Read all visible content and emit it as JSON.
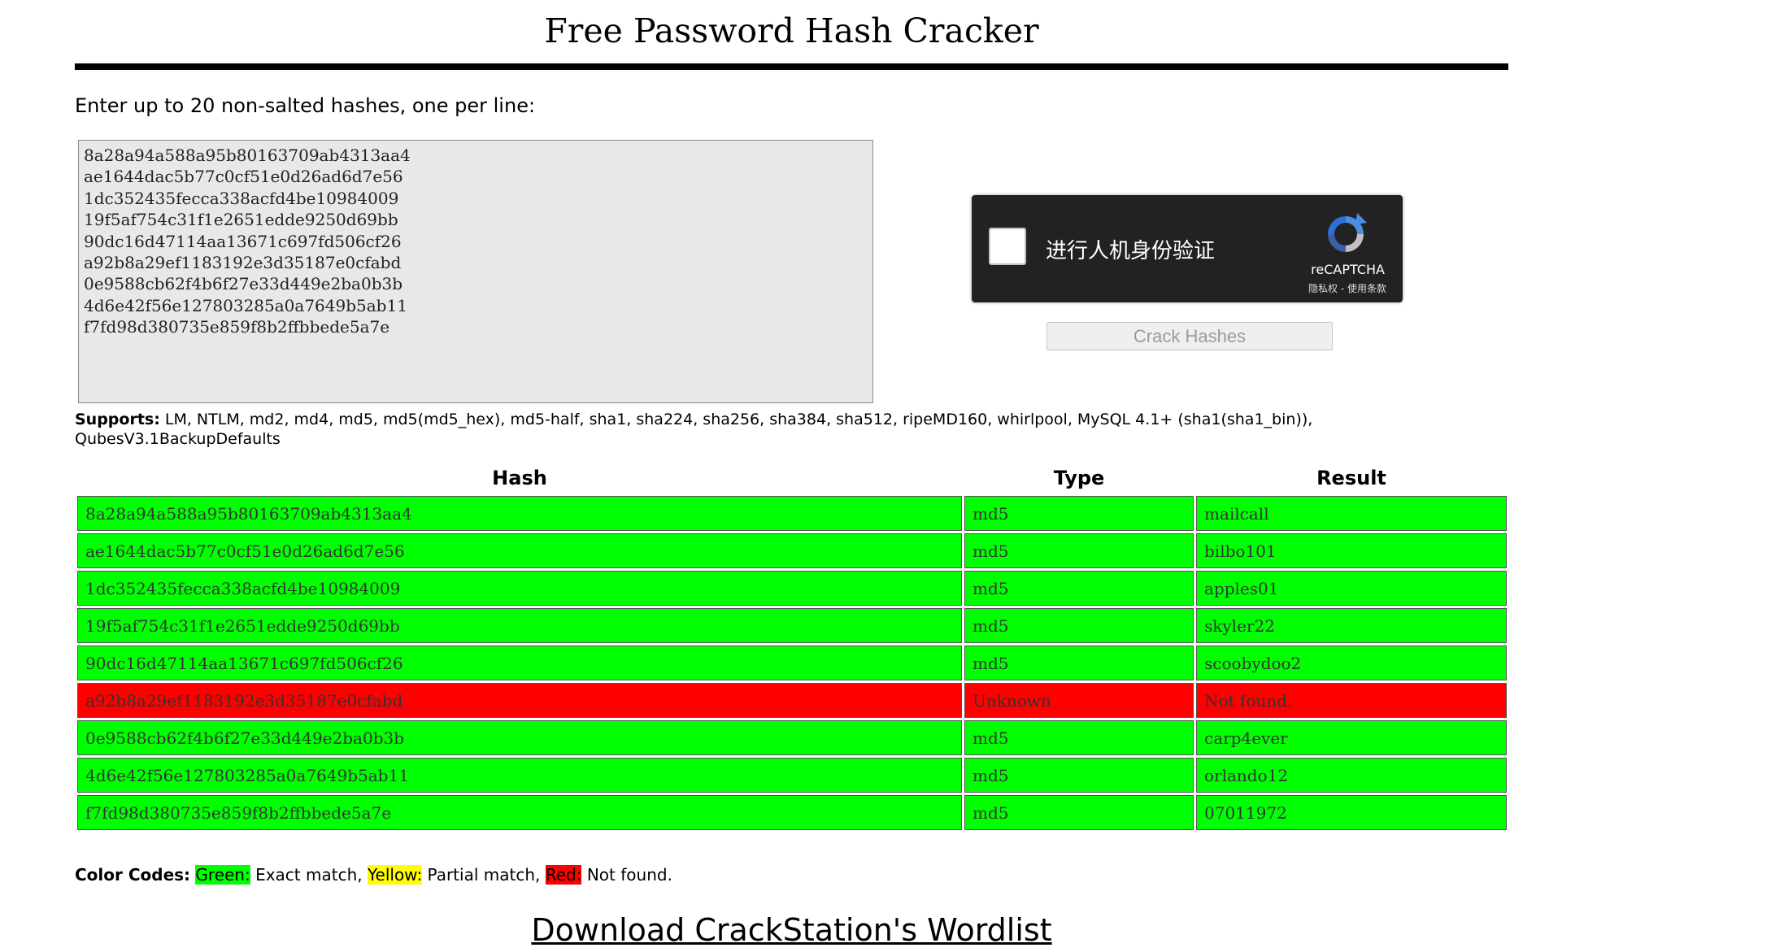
{
  "title": "Free Password Hash Cracker",
  "prompt": "Enter up to 20 non-salted hashes, one per line:",
  "hash_input": "8a28a94a588a95b80163709ab4313aa4\nae1644dac5b77c0cf51e0d26ad6d7e56\n1dc352435fecca338acfd4be10984009\n19f5af754c31f1e2651edde9250d69bb\n90dc16d47114aa13671c697fd506cf26\na92b8a29ef1183192e3d35187e0cfabd\n0e9588cb62f4b6f27e33d449e2ba0b3b\n4d6e42f56e127803285a0a7649b5ab11\nf7fd98d380735e859f8b2ffbbede5a7e",
  "recaptcha": {
    "label": "进行人机身份验证",
    "brand": "reCAPTCHA",
    "privacy": "隐私权",
    "separator": " - ",
    "terms": "使用条款"
  },
  "crack_button": "Crack Hashes",
  "supports": {
    "label": "Supports:",
    "text": " LM, NTLM, md2, md4, md5, md5(md5_hex), md5-half, sha1, sha224, sha256, sha384, sha512, ripeMD160, whirlpool, MySQL 4.1+ (sha1(sha1_bin)), QubesV3.1BackupDefaults"
  },
  "table": {
    "headers": [
      "Hash",
      "Type",
      "Result"
    ],
    "rows": [
      {
        "hash": "8a28a94a588a95b80163709ab4313aa4",
        "type": "md5",
        "result": "mailcall",
        "status": "green"
      },
      {
        "hash": "ae1644dac5b77c0cf51e0d26ad6d7e56",
        "type": "md5",
        "result": "bilbo101",
        "status": "green"
      },
      {
        "hash": "1dc352435fecca338acfd4be10984009",
        "type": "md5",
        "result": "apples01",
        "status": "green"
      },
      {
        "hash": "19f5af754c31f1e2651edde9250d69bb",
        "type": "md5",
        "result": "skyler22",
        "status": "green"
      },
      {
        "hash": "90dc16d47114aa13671c697fd506cf26",
        "type": "md5",
        "result": "scoobydoo2",
        "status": "green"
      },
      {
        "hash": "a92b8a29ef1183192e3d35187e0cfabd",
        "type": "Unknown",
        "result": "Not found.",
        "status": "red"
      },
      {
        "hash": "0e9588cb62f4b6f27e33d449e2ba0b3b",
        "type": "md5",
        "result": "carp4ever",
        "status": "green"
      },
      {
        "hash": "4d6e42f56e127803285a0a7649b5ab11",
        "type": "md5",
        "result": "orlando12",
        "status": "green"
      },
      {
        "hash": "f7fd98d380735e859f8b2ffbbede5a7e",
        "type": "md5",
        "result": "07011972",
        "status": "green"
      }
    ]
  },
  "color_codes": {
    "label": "Color Codes:",
    "green_label": "Green:",
    "green_text": " Exact match, ",
    "yellow_label": "Yellow:",
    "yellow_text": " Partial match, ",
    "red_label": "Red:",
    "red_text": " Not found."
  },
  "wordlist_link": "Download CrackStation's Wordlist",
  "colors": {
    "exact": "#00ff00",
    "partial": "#ffff00",
    "not_found": "#ff0000"
  }
}
